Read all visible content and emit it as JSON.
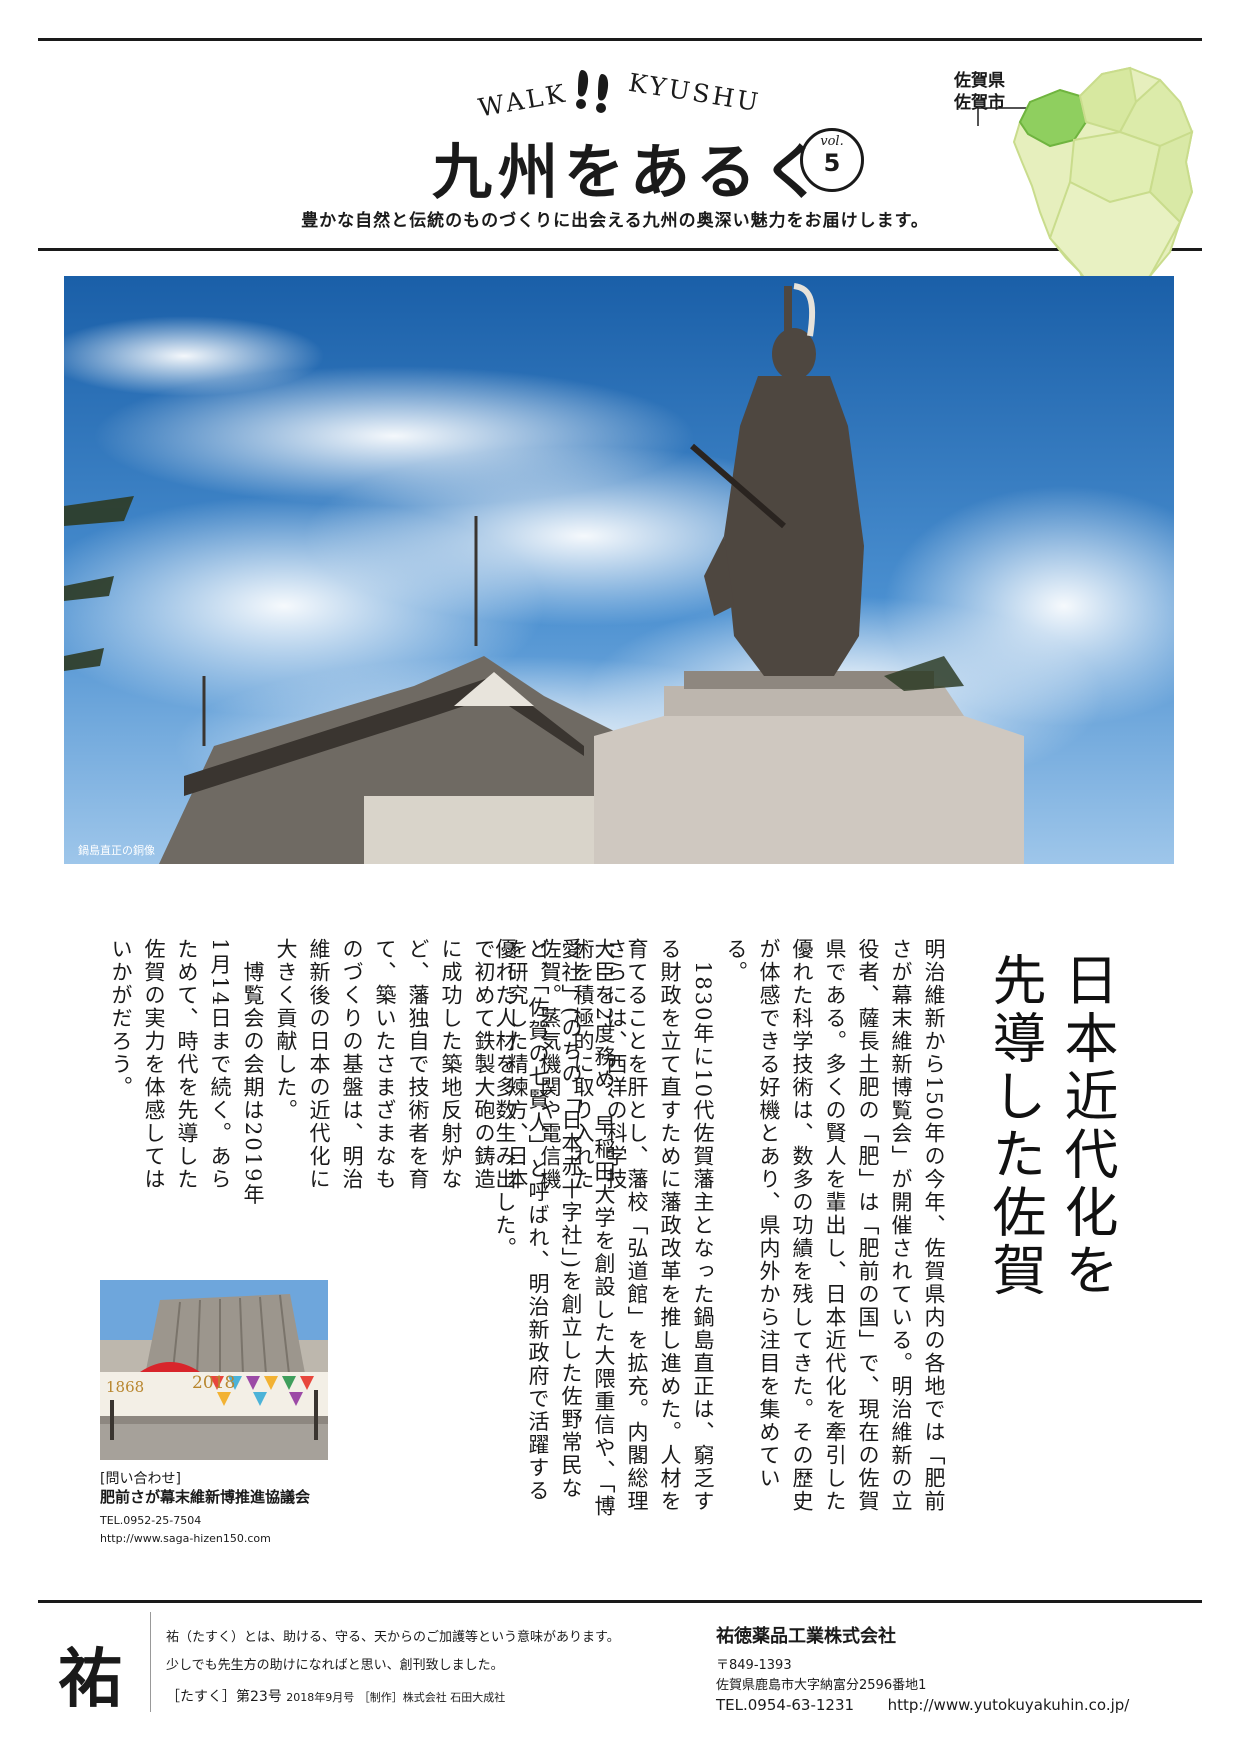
{
  "header": {
    "walk": "WALK",
    "kyushu": "KYUSHU",
    "title": "九州をあるく",
    "vol_label": "vol.",
    "vol_number": "5",
    "tagline": "豊かな自然と伝統のものづくりに出会える九州の奥深い魅力をお届けします。",
    "pref_line1": "佐賀県",
    "pref_line2": "佐賀市"
  },
  "photo": {
    "caption": "鍋島直正の銅像"
  },
  "article": {
    "headline": "日本近代化を\n先導した佐賀",
    "body1": "明治維新から150年の今年、佐賀県内の各地では「肥前さが幕末維新博覧会」が開催されている。明治維新の立役者、薩長土肥の「肥」は「肥前の国」で、現在の佐賀県である。多くの賢人を輩出し、日本近代化を牽引した優れた科学技術は、数多の功績を残してきた。その歴史が体感できる好機とあり、県内外から注目を集めている。\n　1830年に10代佐賀藩主となった鍋島直正は、窮乏する財政を立て直すために藩政改革を推し進めた。人材を育てることを肝とし、藩校「弘道館」を拡充。内閣総理大臣を2度務め、早稲田大学を創設した大隈重信や、「博愛社」(のちの「日本赤十字社」)を創立した佐野常民など、「佐賀の七賢人」と呼ばれ、明治新政府で活躍する優れた人材を多数生み出した。",
    "body2": "さらには、西洋の科学技術を積極的に取り入れた佐賀。蒸気機関や電信機を研究した精煉方、日本で初めて鉄製大砲の鋳造に成功した築地反射炉など、藩独自で技術者を育て、築いたさまざまなものづくりの基盤は、明治維新後の日本の近代化に大きく貢献した。\n　博覧会の会期は2019年1月14日まで続く。あらためて、時代を先導した佐賀の実力を体感してはいかがだろう。"
  },
  "inset_photo": {
    "sign_year_left": "1868",
    "sign_year_right": "2018"
  },
  "inquiry": {
    "heading": "[問い合わせ]",
    "org": "肥前さが幕末維新博推進協議会",
    "tel": "TEL.0952-25-7504",
    "url": "http://www.saga-hizen150.com"
  },
  "footer": {
    "kanji": "祐",
    "desc_line1": "祐（たすく）とは、助ける、守る、天からのご加護等という意味があります。",
    "desc_line2": "少しでも先生方の助けになればと思い、創刊致しました。",
    "issue_name": "［たすく］第23号",
    "issue_date": "2018年9月号",
    "producer": "［制作］株式会社 石田大成社",
    "company": "祐徳薬品工業株式会社",
    "postal": "〒849-1393",
    "address": "佐賀県鹿島市大字納富分2596番地1",
    "tel": "TEL.0954-63-1231",
    "url": "http://www.yutokuyakuhin.co.jp/"
  }
}
